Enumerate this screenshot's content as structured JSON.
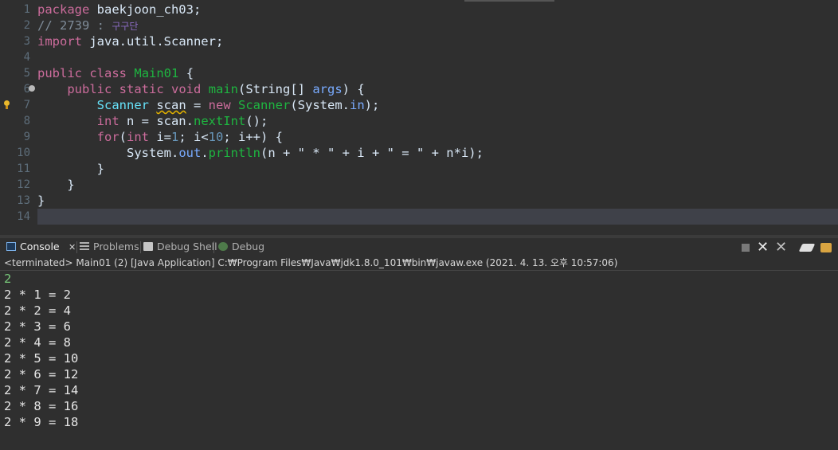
{
  "editor": {
    "line_numbers": [
      "1",
      "2",
      "3",
      "4",
      "5",
      "6",
      "7",
      "8",
      "9",
      "10",
      "11",
      "12",
      "13",
      "14"
    ],
    "l1": {
      "kw": "package",
      "rest": " baekjoon_ch03;"
    },
    "l2": {
      "comment": "// 2739 : ",
      "comment_korean": "구구단"
    },
    "l3": {
      "kw": "import",
      "rest": " java.util.Scanner;"
    },
    "l5": {
      "kw1": "public",
      "kw2": "class",
      "name": "Main01",
      "brace": " {"
    },
    "l6": {
      "kw1": "public",
      "kw2": "static",
      "kw3": "void",
      "method": "main",
      "p1": "(String[] ",
      "param": "args",
      "p2": ") {"
    },
    "l7": {
      "type": "Scanner",
      "var": "scan",
      "eq": " = ",
      "kw": "new",
      "ctor": "Scanner",
      "p1": "(System.",
      "field": "in",
      "p2": ");"
    },
    "l8": {
      "kw": "int",
      "rest": " n = scan.",
      "method": "nextInt",
      "end": "();"
    },
    "l9": {
      "kw": "for",
      "p1": "(",
      "kw2": "int",
      "rest1": " i=",
      "num1": "1",
      "rest2": "; i<",
      "num2": "10",
      "rest3": "; i++) {"
    },
    "l10": {
      "cls": "System.",
      "field": "out",
      "dot": ".",
      "method": "println",
      "rest": "(n + \" * \" + i + \" = \" + n*i);"
    },
    "l11": {
      "text": "}"
    },
    "l12": {
      "text": "}"
    },
    "l13": {
      "text": "}"
    }
  },
  "console_view": {
    "tabs": [
      {
        "label": "Console",
        "icon": "console-icon",
        "close": "✕"
      },
      {
        "label": "Problems",
        "icon": "problems-icon"
      },
      {
        "label": "Debug Shell",
        "icon": "debug-shell-icon"
      },
      {
        "label": "Debug",
        "icon": "debug-icon"
      }
    ],
    "status": "<terminated> Main01 (2) [Java Application] C:₩Program Files₩Java₩jdk1.8.0_101₩bin₩javaw.exe (2021. 4. 13. 오후 10:57:06)",
    "toolbar": {
      "terminate": "■",
      "remove": "✕",
      "remove_all": "✕",
      "clear": "clear-console-icon",
      "lock": "scroll-lock-icon"
    },
    "input_line": "2",
    "output_lines": [
      "2 * 1 = 2",
      "2 * 2 = 4",
      "2 * 3 = 6",
      "2 * 4 = 8",
      "2 * 5 = 10",
      "2 * 6 = 12",
      "2 * 7 = 14",
      "2 * 8 = 16",
      "2 * 9 = 18"
    ]
  },
  "colors": {
    "background": "#2f2f2f",
    "keyword": "#cc6c9c",
    "type": "#1eb540",
    "field": "#66e1f8",
    "console_input": "#78c87a"
  }
}
